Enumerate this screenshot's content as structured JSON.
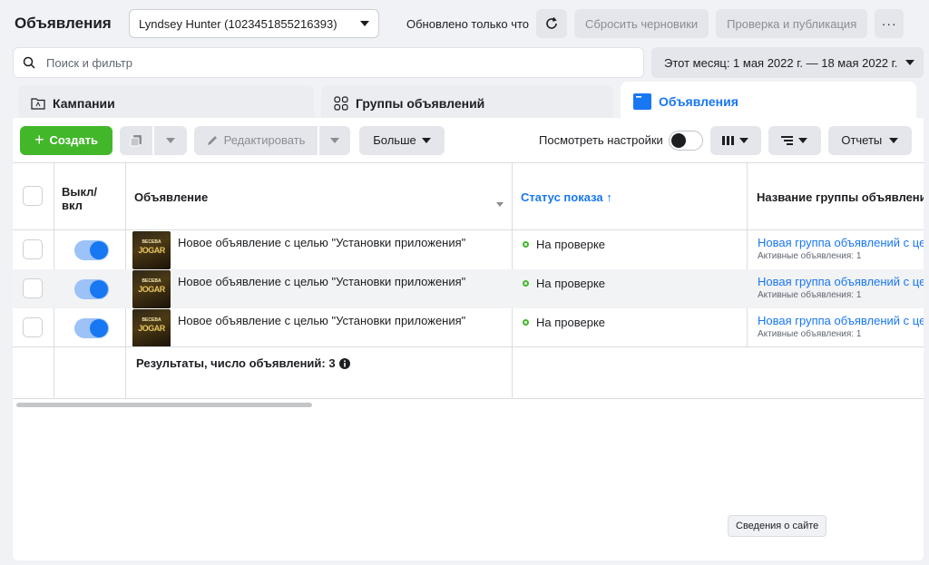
{
  "header": {
    "title": "Объявления",
    "account": "Lyndsey Hunter (1023451855216393)",
    "updated": "Обновлено только что",
    "discard_drafts": "Сбросить черновики",
    "review_publish": "Проверка и публикация",
    "more": "···"
  },
  "search": {
    "placeholder": "Поиск и фильтр",
    "date_range": "Этот месяц: 1 мая 2022 г. — 18 мая 2022 г."
  },
  "tabs": [
    {
      "label": "Кампании",
      "icon": "folder-icon"
    },
    {
      "label": "Группы объявлений",
      "icon": "grid-icon"
    },
    {
      "label": "Объявления",
      "icon": "ad-icon",
      "active": true
    }
  ],
  "toolbar": {
    "create": "Создать",
    "edit": "Редактировать",
    "more": "Больше",
    "view_settings": "Посмотреть настройки",
    "reports": "Отчеты"
  },
  "table": {
    "columns": {
      "onoff": "Выкл/\nвкл",
      "ad": "Объявление",
      "status": "Статус показа ↑",
      "adset": "Название группы объявлени"
    },
    "rows": [
      {
        "on": true,
        "ad": "Новое объявление с целью \"Установки приложения\"",
        "status": "На проверке",
        "adset": "Новая группа объявлений с це",
        "adset_sub": "Активные объявления: 1",
        "thumb_top": "BECEBA",
        "thumb_main": "JOGAR"
      },
      {
        "on": true,
        "ad": "Новое объявление с целью \"Установки приложения\"",
        "status": "На проверке",
        "adset": "Новая группа объявлений с це",
        "adset_sub": "Активные объявления: 1",
        "thumb_top": "BECEBA",
        "thumb_main": "JOGAR"
      },
      {
        "on": true,
        "ad": "Новое объявление с целью \"Установки приложения\"",
        "status": "На проверке",
        "adset": "Новая группа объявлений с це",
        "adset_sub": "Активные объявления: 1",
        "thumb_top": "BECEBA",
        "thumb_main": "JOGAR"
      }
    ],
    "results": "Результаты, число объявлений: 3"
  },
  "tooltip": "Сведения о сайте",
  "colors": {
    "primary": "#1877f2",
    "create": "#42b72a",
    "status_dot": "#42b72a"
  }
}
